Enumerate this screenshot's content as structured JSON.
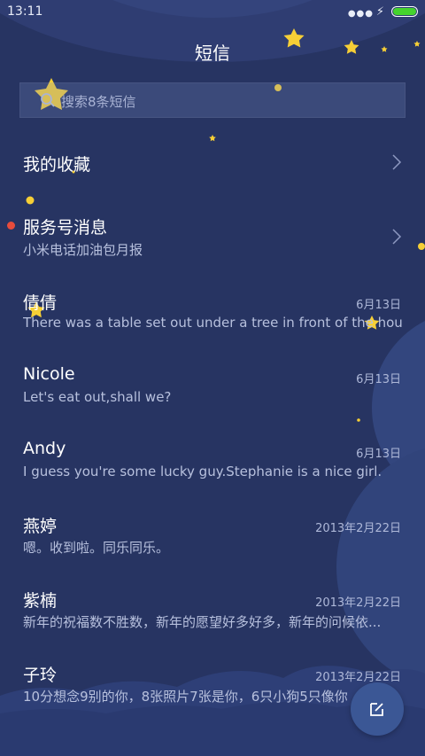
{
  "status": {
    "time": "13:11"
  },
  "header": {
    "title": "短信"
  },
  "search": {
    "placeholder": "搜索8条短信"
  },
  "favorites": {
    "label": "我的收藏"
  },
  "service": {
    "title": "服务号消息",
    "subtitle": "小米电话加油包月报"
  },
  "messages": [
    {
      "name": "倩倩",
      "preview": "There was a table set out under a tree in front of the hous",
      "date": "6月13日"
    },
    {
      "name": "Nicole",
      "preview": "Let's eat out,shall we?",
      "date": "6月13日"
    },
    {
      "name": "Andy",
      "preview": "I guess you're some lucky guy.Stephanie is a nice girl.",
      "date": "6月13日"
    },
    {
      "name": "燕婷",
      "preview": "嗯。收到啦。同乐同乐。",
      "date": "2013年2月22日"
    },
    {
      "name": "紫楠",
      "preview": "新年的祝福数不胜数，新年的愿望好多好多，新年的问候依...",
      "date": "2013年2月22日"
    },
    {
      "name": "子玲",
      "preview": "10分想念9别的你，8张照片7张是你，6只小狗5只像你",
      "date": "2013年2月22日"
    }
  ],
  "colors": {
    "background": "#273462",
    "accent_star": "#f6cf36",
    "unread_dot": "#e74c3c",
    "battery": "#45d32e",
    "compose_button": "#3b5795"
  },
  "icons": {
    "search": "search-icon",
    "chevron": "chevron-right-icon",
    "compose": "compose-icon",
    "battery": "battery-icon",
    "signal": "signal-icon"
  }
}
